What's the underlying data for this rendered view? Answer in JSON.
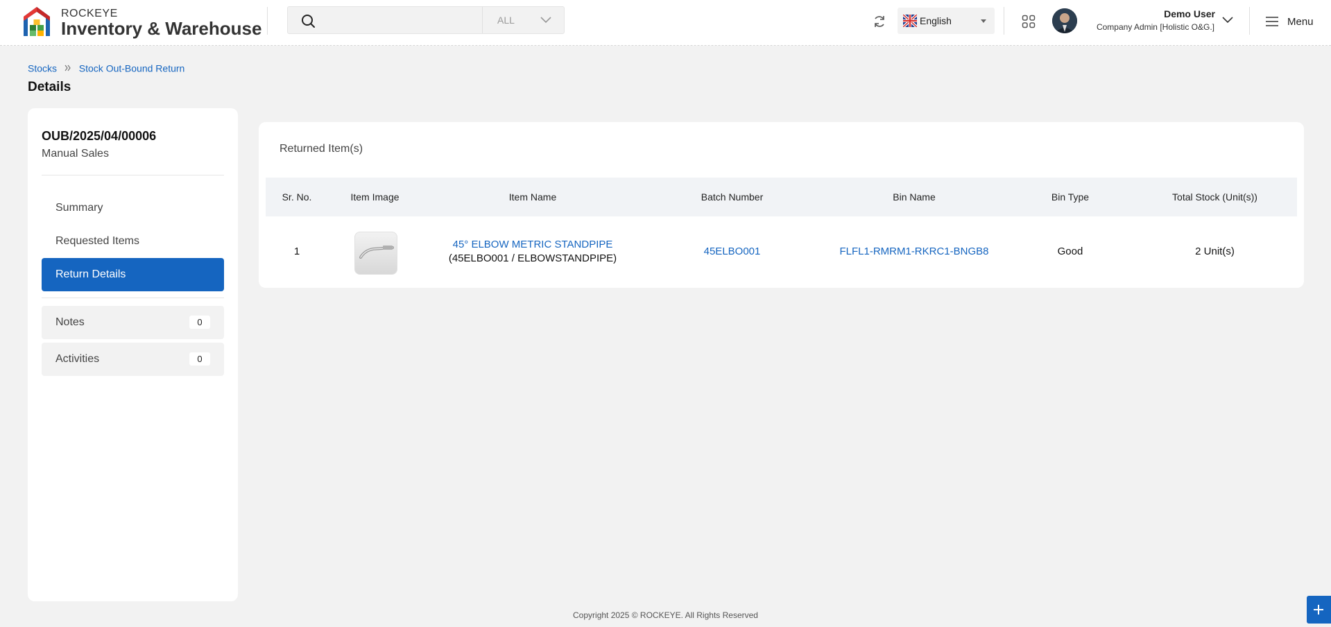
{
  "brand": {
    "top": "ROCKEYE",
    "main": "Inventory & Warehouse"
  },
  "search": {
    "placeholder": "",
    "scope": "ALL"
  },
  "language": {
    "selected": "English"
  },
  "user": {
    "name": "Demo User",
    "role": "Company Admin [Holistic O&G.]"
  },
  "menu": {
    "label": "Menu"
  },
  "breadcrumb": {
    "items": [
      "Stocks",
      "Stock Out-Bound Return"
    ]
  },
  "page": {
    "title": "Details"
  },
  "record": {
    "id": "OUB/2025/04/00006",
    "type": "Manual Sales"
  },
  "nav": {
    "items": [
      {
        "label": "Summary"
      },
      {
        "label": "Requested Items"
      },
      {
        "label": "Return Details"
      }
    ],
    "notes": {
      "label": "Notes",
      "count": "0"
    },
    "activities": {
      "label": "Activities",
      "count": "0"
    }
  },
  "returned": {
    "title": "Returned Item(s)",
    "columns": [
      "Sr. No.",
      "Item Image",
      "Item Name",
      "Batch Number",
      "Bin Name",
      "Bin Type",
      "Total Stock (Unit(s))"
    ],
    "rows": [
      {
        "sr": "1",
        "name": "45° ELBOW METRIC STANDPIPE",
        "code": "(45ELBO001 / ELBOWSTANDPIPE)",
        "batch": "45ELBO001",
        "bin": "FLFL1-RMRM1-RKRC1-BNGB8",
        "bin_type": "Good",
        "total": "2 Unit(s)"
      }
    ]
  },
  "footer": {
    "copyright": "Copyright 2025 © ROCKEYE. All Rights Reserved"
  },
  "colors": {
    "accent": "#1565c0",
    "background": "#f2f2f2"
  }
}
